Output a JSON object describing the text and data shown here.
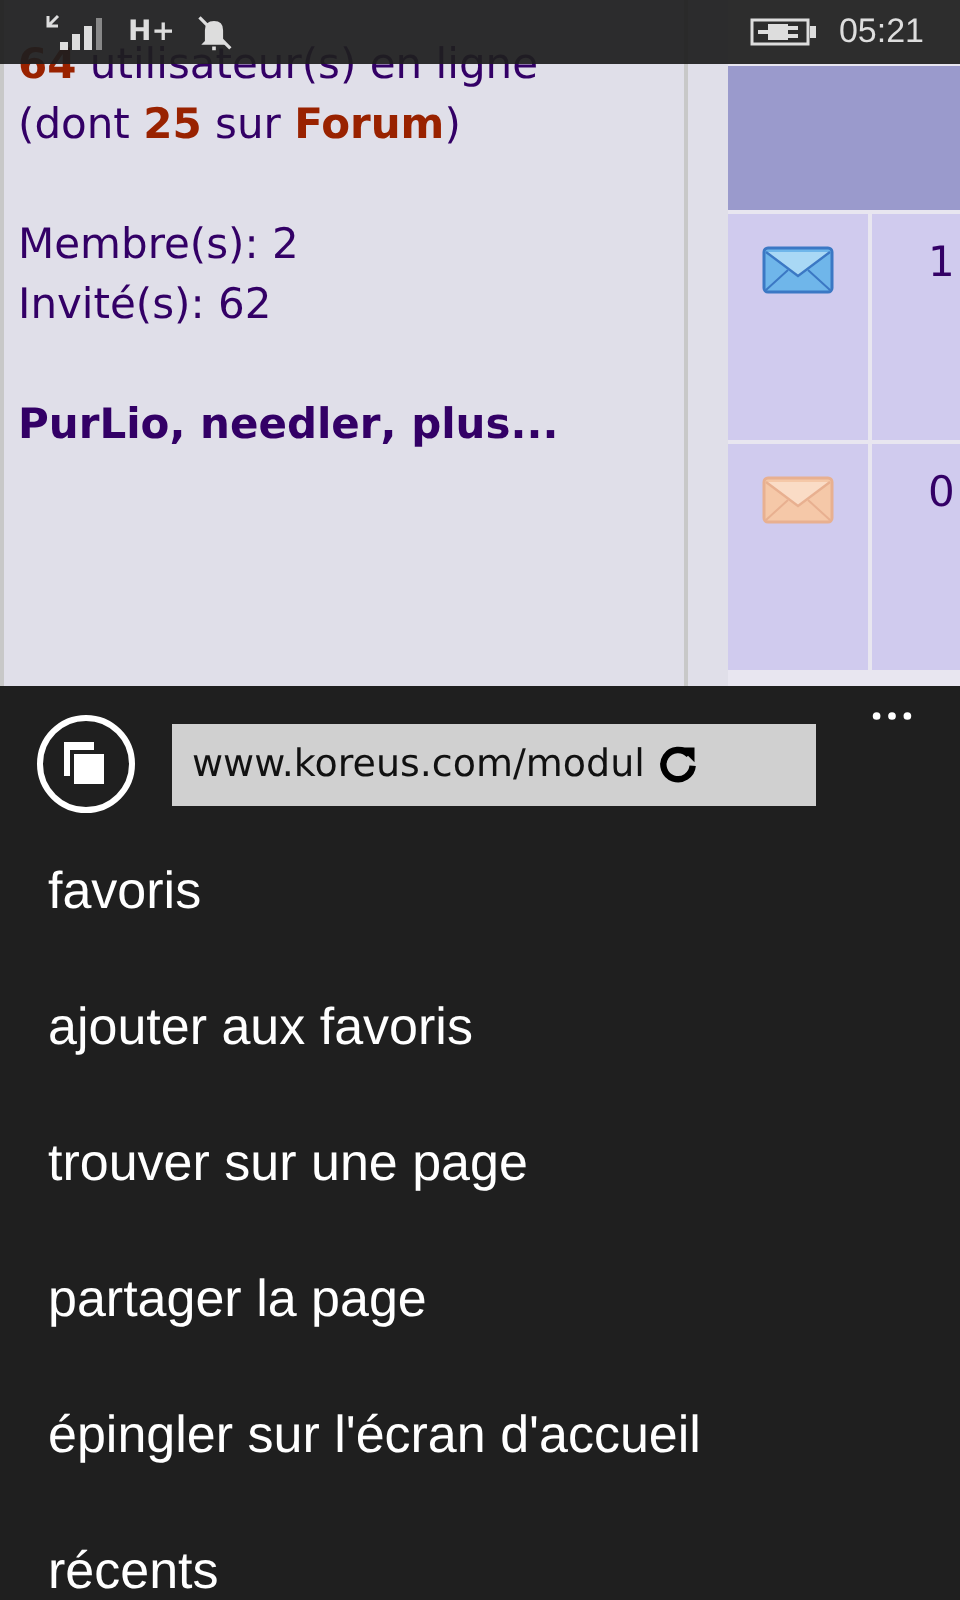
{
  "status_bar": {
    "network": "H+",
    "time": "05:21"
  },
  "page": {
    "online": "**64** utilisateur(s) en ligne",
    "online_detail": "(dont **25** sur **Forum**)",
    "members": "Membre(s): 2",
    "guests": "Invité(s): 62",
    "names": "**PurLio**, **needler**, **plus...**",
    "table_rows": [
      {
        "kind": "new",
        "count": "1"
      },
      {
        "kind": "read",
        "count": "0"
      }
    ]
  },
  "address_bar": {
    "url": "www.koreus.com/modul"
  },
  "menu": [
    "favoris",
    "ajouter aux favoris",
    "trouver sur une page",
    "partager la page",
    "épingler sur l'écran d'accueil",
    "récents"
  ]
}
